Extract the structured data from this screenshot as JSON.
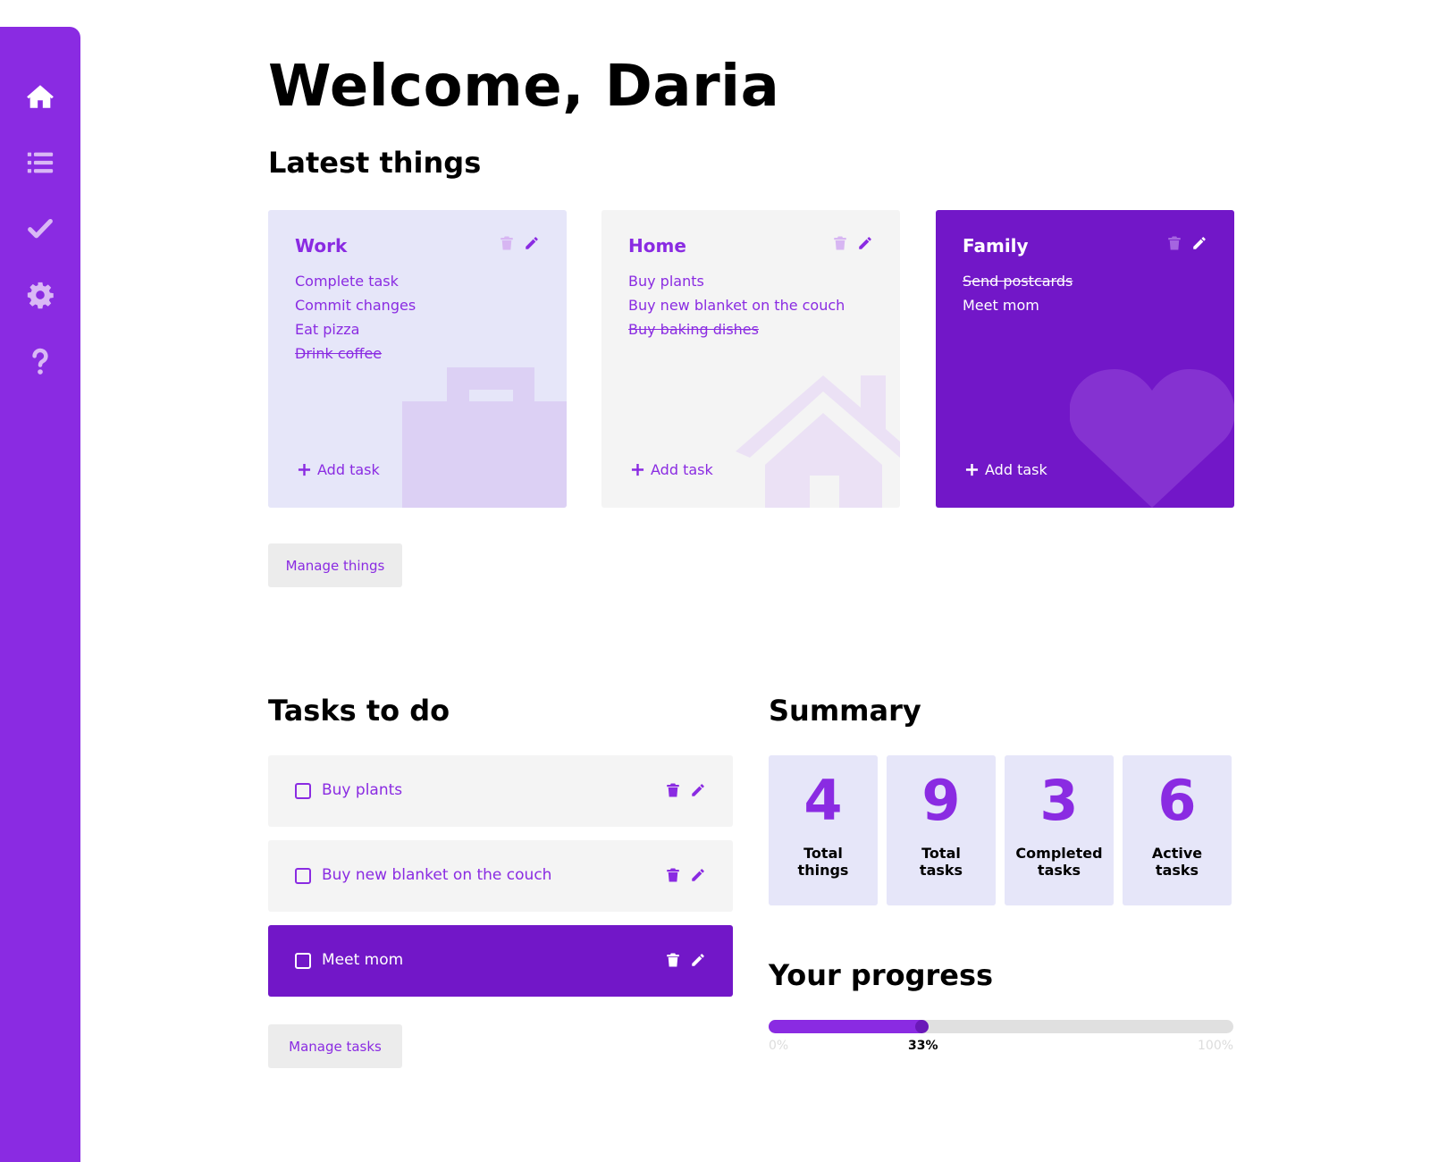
{
  "nav": [
    {
      "name": "home-icon"
    },
    {
      "name": "list-icon"
    },
    {
      "name": "checkmark-icon"
    },
    {
      "name": "gear-icon"
    },
    {
      "name": "help-icon"
    }
  ],
  "welcome": "Welcome, Daria",
  "latest_title": "Latest things",
  "things": [
    {
      "title": "Work",
      "tasks": [
        {
          "text": "Complete task",
          "done": false
        },
        {
          "text": "Commit changes",
          "done": false
        },
        {
          "text": "Eat pizza",
          "done": false
        },
        {
          "text": "Drink coffee",
          "done": true
        }
      ],
      "add_label": "Add task",
      "background_icon": "briefcase-icon"
    },
    {
      "title": "Home",
      "tasks": [
        {
          "text": "Buy plants",
          "done": false
        },
        {
          "text": "Buy new blanket on the couch",
          "done": false
        },
        {
          "text": "Buy baking dishes",
          "done": true
        }
      ],
      "add_label": "Add task",
      "background_icon": "house-icon"
    },
    {
      "title": "Family",
      "tasks": [
        {
          "text": "Send postcards",
          "done": true
        },
        {
          "text": "Meet mom",
          "done": false
        }
      ],
      "add_label": "Add task",
      "background_icon": "heart-icon"
    }
  ],
  "manage_things_label": "Manage things",
  "tasks_title": "Tasks to do",
  "tasks": [
    {
      "text": "Buy plants",
      "checked": false,
      "active": false
    },
    {
      "text": "Buy new blanket on the couch",
      "checked": false,
      "active": false
    },
    {
      "text": "Meet mom",
      "checked": false,
      "active": true
    }
  ],
  "manage_tasks_label": "Manage tasks",
  "summary_title": "Summary",
  "summary": [
    {
      "value": "4",
      "label_line1": "Total",
      "label_line2": "things"
    },
    {
      "value": "9",
      "label_line1": "Total",
      "label_line2": "tasks"
    },
    {
      "value": "3",
      "label_line1": "Completed",
      "label_line2": "tasks"
    },
    {
      "value": "6",
      "label_line1": "Active",
      "label_line2": "tasks"
    }
  ],
  "progress_title": "Your progress",
  "progress": {
    "value": 0.33,
    "min_label": "0%",
    "current_label": "33%",
    "max_label": "100%"
  },
  "colors": {
    "accent": "#8a2be2",
    "accent_dark": "#7217c8",
    "card_light": "#e6e6f9",
    "card_gray": "#f4f4f4"
  }
}
